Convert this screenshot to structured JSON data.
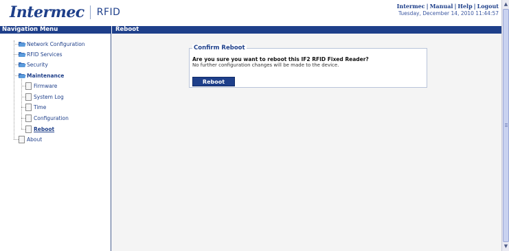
{
  "header": {
    "logo_word": "Intermec",
    "logo_product": "RFID",
    "links": [
      "Intermec",
      "Manual",
      "Help",
      "Logout"
    ],
    "datetime": "Tuesday, December 14, 2010 11:44:57"
  },
  "nav": {
    "title": "Navigation Menu",
    "items": [
      {
        "label": "Network Configuration",
        "icon": "folder-icon"
      },
      {
        "label": "RFID Services",
        "icon": "folder-icon"
      },
      {
        "label": "Security",
        "icon": "folder-icon"
      },
      {
        "label": "Maintenance",
        "icon": "folder-icon"
      },
      {
        "label": "Firmware",
        "icon": "page-icon"
      },
      {
        "label": "System Log",
        "icon": "page-icon"
      },
      {
        "label": "Time",
        "icon": "page-icon"
      },
      {
        "label": "Configuration",
        "icon": "page-icon"
      },
      {
        "label": "Reboot",
        "icon": "page-icon"
      },
      {
        "label": "About",
        "icon": "page-icon"
      }
    ]
  },
  "content": {
    "title": "Reboot",
    "box_title": "Confirm Reboot",
    "question": "Are you sure you want to reboot this IF2 RFID Fixed Reader?",
    "note": "No further configuration changes will be made to the device.",
    "button_label": "Reboot"
  },
  "colors": {
    "brand": "#1e3f8a",
    "folder": "#3b6fb8",
    "content_bg": "#f4f4f4"
  }
}
